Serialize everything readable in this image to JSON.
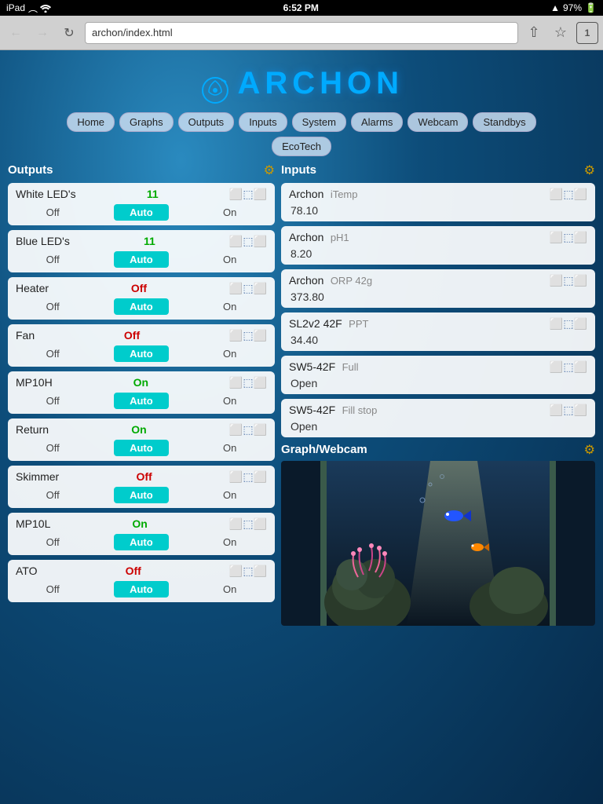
{
  "statusBar": {
    "left": "iPad",
    "wifi": "WiFi",
    "time": "6:52 PM",
    "signal": "▲",
    "battery": "97%"
  },
  "browser": {
    "url": "archon/index.html",
    "tabCount": "1"
  },
  "logo": {
    "text": "ARCHON"
  },
  "nav": {
    "items": [
      "Home",
      "Graphs",
      "Outputs",
      "Inputs",
      "System",
      "Alarms",
      "Webcam",
      "Standbys"
    ],
    "secondary": [
      "EcoTech"
    ]
  },
  "outputs": {
    "title": "Outputs",
    "items": [
      {
        "name": "White LED's",
        "status": "11",
        "statusClass": "status-green",
        "off": "Off",
        "auto": "Auto",
        "on": "On"
      },
      {
        "name": "Blue LED's",
        "status": "11",
        "statusClass": "status-green",
        "off": "Off",
        "auto": "Auto",
        "on": "On"
      },
      {
        "name": "Heater",
        "status": "Off",
        "statusClass": "status-red",
        "off": "Off",
        "auto": "Auto",
        "on": "On"
      },
      {
        "name": "Fan",
        "status": "Off",
        "statusClass": "status-red",
        "off": "Off",
        "auto": "Auto",
        "on": "On"
      },
      {
        "name": "MP10H",
        "status": "On",
        "statusClass": "status-green",
        "off": "Off",
        "auto": "Auto",
        "on": "On"
      },
      {
        "name": "Return",
        "status": "On",
        "statusClass": "status-green",
        "off": "Off",
        "auto": "Auto",
        "on": "On"
      },
      {
        "name": "Skimmer",
        "status": "Off",
        "statusClass": "status-red",
        "off": "Off",
        "auto": "Auto",
        "on": "On"
      },
      {
        "name": "MP10L",
        "status": "On",
        "statusClass": "status-green",
        "off": "Off",
        "auto": "Auto",
        "on": "On"
      },
      {
        "name": "ATO",
        "status": "Off",
        "statusClass": "status-red",
        "off": "Off",
        "auto": "Auto",
        "on": "On"
      }
    ]
  },
  "inputs": {
    "title": "Inputs",
    "items": [
      {
        "source": "Archon",
        "name": "iTemp",
        "value": "78.10"
      },
      {
        "source": "Archon",
        "name": "pH1",
        "value": "8.20"
      },
      {
        "source": "Archon",
        "name": "ORP 42g",
        "value": "373.80"
      },
      {
        "source": "SL2v2 42F",
        "name": "PPT",
        "value": "34.40"
      },
      {
        "source": "SW5-42F",
        "name": "Full",
        "value": "Open"
      },
      {
        "source": "SW5-42F",
        "name": "Fill stop",
        "value": "Open"
      }
    ]
  },
  "graphWebcam": {
    "title": "Graph/Webcam"
  }
}
